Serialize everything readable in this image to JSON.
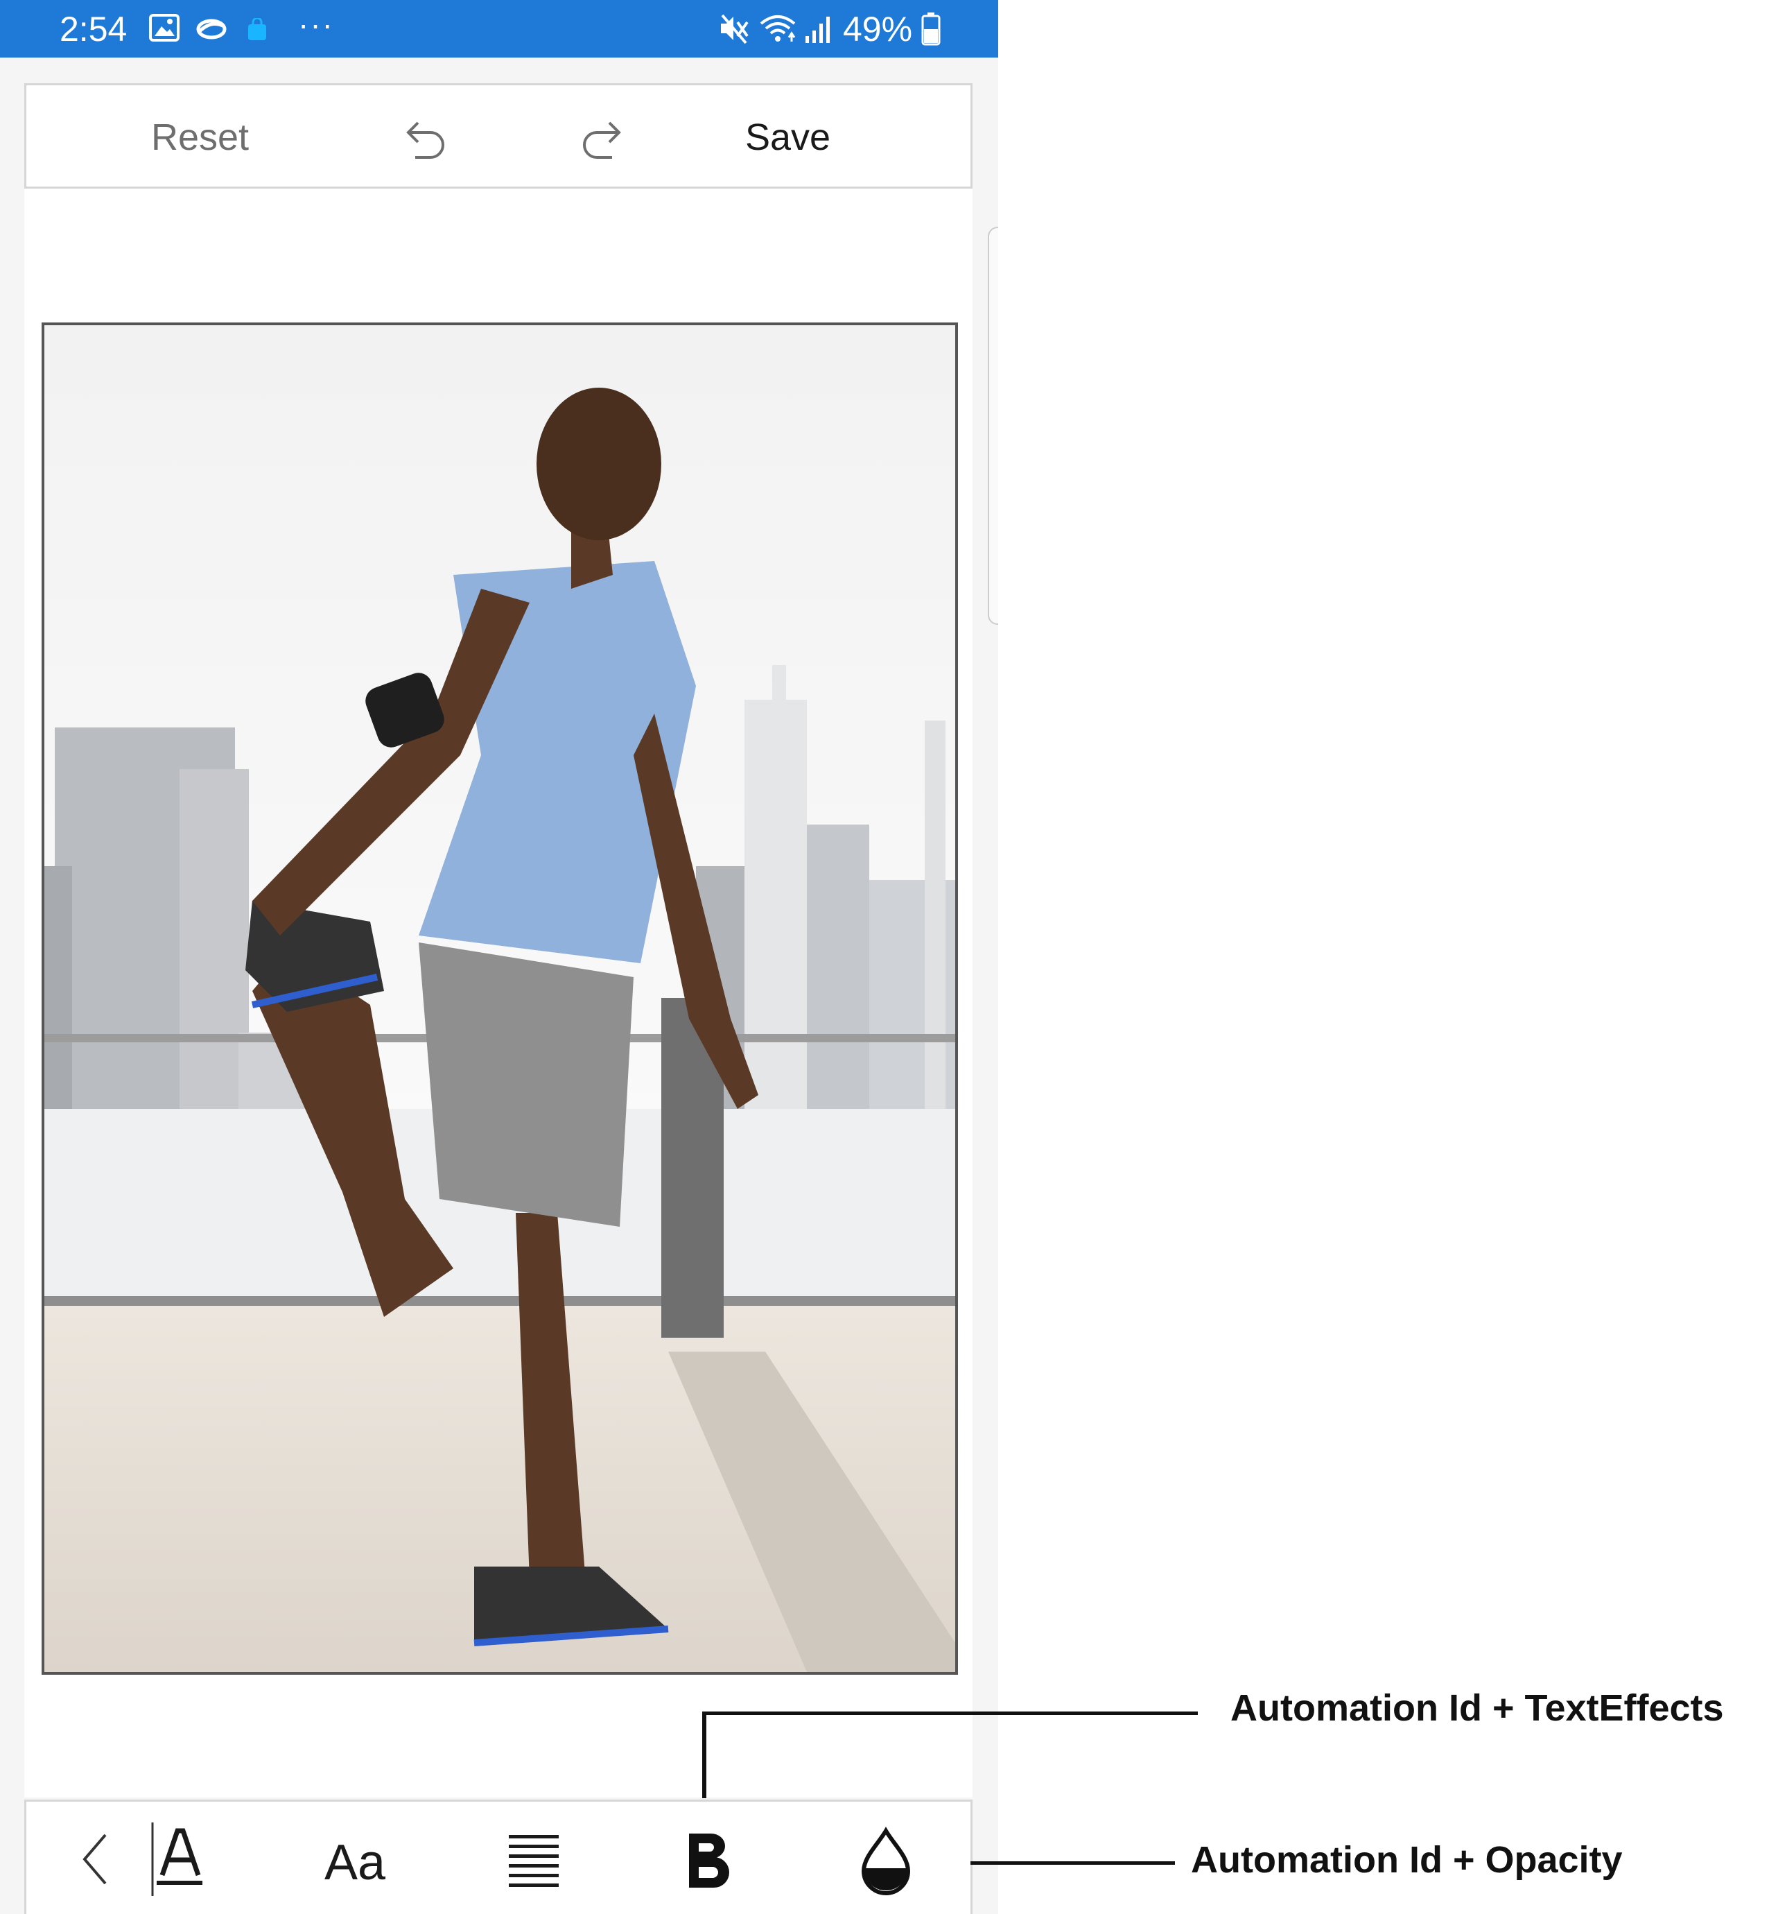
{
  "status_bar": {
    "time": "2:54",
    "battery": "49%",
    "more": "···",
    "icons": [
      "image-icon",
      "cloud-icon",
      "bag-icon",
      "mute-icon",
      "wifi-icon",
      "signal-icon",
      "battery-icon"
    ]
  },
  "top_toolbar": {
    "reset_label": "Reset",
    "save_label": "Save",
    "icons": [
      "undo-icon",
      "redo-icon"
    ]
  },
  "bottom_toolbar": {
    "font_size_label": "Aa",
    "icons": [
      "back-chevron-icon",
      "text-color-icon",
      "font-size-icon",
      "align-justify-icon",
      "bold-icon",
      "opacity-icon"
    ]
  },
  "callouts": {
    "text_effects": "Automation Id + TextEffects",
    "opacity": "Automation Id + Opacity"
  },
  "colors": {
    "status_bar": "#1f79d6",
    "toolbar_border": "#d6d6d6"
  }
}
